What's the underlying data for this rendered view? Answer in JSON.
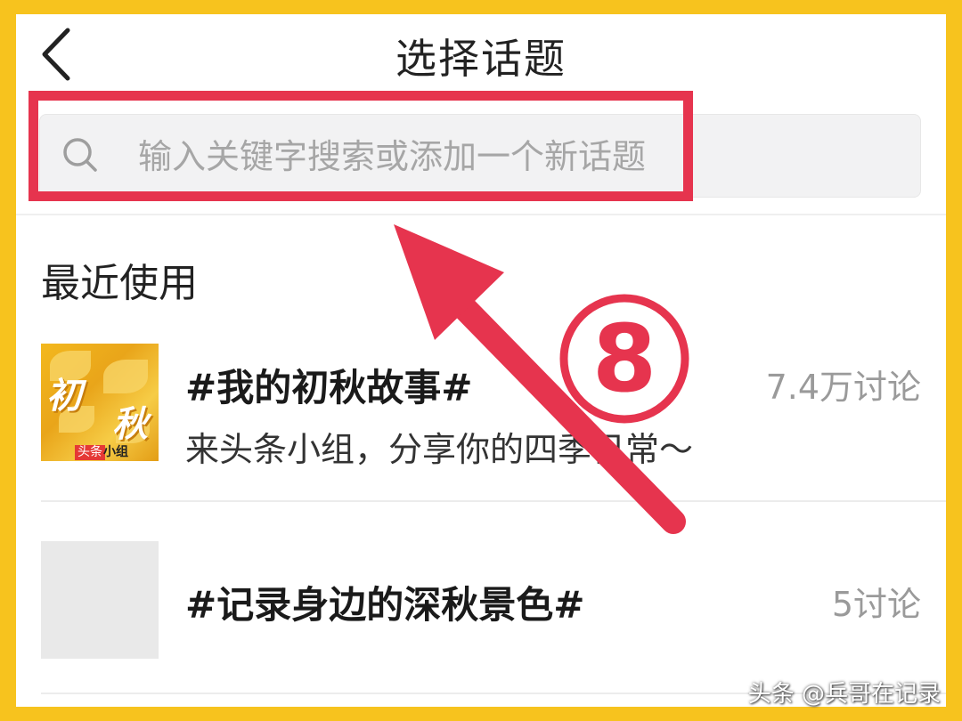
{
  "header": {
    "title": "选择话题",
    "back_icon": "chevron-left-icon"
  },
  "search": {
    "placeholder": "输入关键字搜索或添加一个新话题",
    "icon": "search-icon"
  },
  "recent": {
    "section_title": "最近使用",
    "topics": [
      {
        "title": "#我的初秋故事#",
        "description": "来头条小组，分享你的四季日常～",
        "count": "7.4万讨论",
        "thumbnail_text": [
          "初",
          "秋"
        ],
        "thumbnail_badge": [
          "头条",
          "小组"
        ]
      },
      {
        "title": "#记录身边的深秋景色#",
        "count": "5讨论"
      }
    ]
  },
  "annotation": {
    "step": "8",
    "color": "#E6344E"
  },
  "watermark": "头条 @兵哥在记录",
  "colors": {
    "frame": "#F7C31E",
    "annotation": "#E6344E",
    "count": "#9a9a9a"
  }
}
